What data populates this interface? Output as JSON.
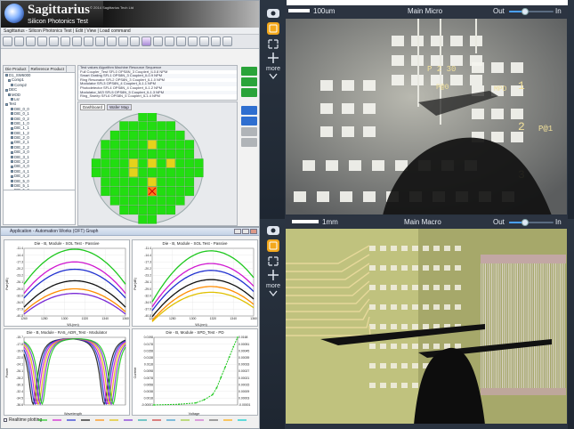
{
  "sagittarius": {
    "app_name": "Sagittarius",
    "copyright": "© 2014 Sagittarius Tech Ltd",
    "subtitle": "Silicon Photonics Test",
    "menu": "Sagittarius - Silicon Photonics Test  |  Edit  |  View  |  Load command",
    "tree_tabs": [
      "Die Product",
      "Reference Product"
    ],
    "tree_items": [
      "D1_SW6000",
      "Comp1",
      "Comp2",
      "DEC",
      "MOD",
      "Lsr",
      "Test",
      "DIE_0_0",
      "DIE_0_1",
      "DIE_0_2",
      "DIE_1_0",
      "DIE_1_1",
      "DIE_1_2",
      "DIE_2_0",
      "DIE_2_1",
      "DIE_2_2",
      "DIE_3_0",
      "DIE_3_1",
      "DIE_3_2",
      "DIE_4_0",
      "DIE_4_1",
      "DIE_4_2",
      "DIE_5_0",
      "DIE_5_1",
      "DIE_5_2",
      "DIE_6_0",
      "DIE_6_1",
      "DIE_6_2",
      "DIE_7_0",
      "DIE_7_1"
    ],
    "params_rows": [
      "Test values   Algorithm     Machine        Resource    Sequence",
      "  Full     Coupler_Test            SFL0     OPS8N_3 Couplert_IL0.8 NPM",
      "  Smart    Grating                 SFL1     OPS8N_3 Couplert_IL0.9 NPM",
      "           Ring Resonator          SFL2     OPS8N_3 Couplert_IL1.0 NPM",
      "           Modulator               SFL3     OPS8N_4 Couplert_IL1.1 NPM",
      "           Photodetector           SFL4     OPS8N_4 Couplert_IL1.2 NPM",
      "           Modulator_MZI           SFL5     OPS8N_5 Couplert_IL1.3 NPM",
      "           Ring_Sweep              SFL6     OPS8N_5 Couplert_IL1.4 NPM"
    ],
    "wafer_tabs": [
      "Dashboard",
      "Wafer Map"
    ],
    "buttons": {
      "colors": [
        "#2aa43a",
        "#2aa43a",
        "#2aa43a",
        "#2f6fd0",
        "#2f6fd0",
        "#b0b4b8",
        "#b0b4b8"
      ]
    },
    "wafer": {
      "pass_color": "#22dd11",
      "select_color": "#e5d21b",
      "fail_color": "#ff7a1a",
      "selected": [
        [
          6,
          3
        ],
        [
          4,
          5
        ],
        [
          6,
          5
        ],
        [
          8,
          5
        ],
        [
          4,
          6
        ],
        [
          6,
          7
        ],
        [
          6,
          8
        ]
      ]
    }
  },
  "automation": {
    "title": "Application - Automation Works (OFT) Graph",
    "realtime_label": "Realtime plotting",
    "plots": [
      {
        "title": "Die - B, Module - SOL Test - Passive",
        "xlabel": "WL(nm)",
        "ylabel": "Pwr(dB)"
      },
      {
        "title": "Die - B, Module - SOL Test - Passive",
        "xlabel": "WL(nm)",
        "ylabel": "Pwr(dB)"
      },
      {
        "title": "Die - B, Module - RA5_ADR_Test - Modulator",
        "xlabel": "Wavelength",
        "ylabel": "Power"
      },
      {
        "title": "Die - B, Module - SPD_Test - PD",
        "xlabel": "Voltage",
        "ylabel": "Current"
      }
    ]
  },
  "chart_data": [
    {
      "type": "line",
      "title": "Die - B, Module - SOL Test - Passive",
      "xlabel": "WL(nm)",
      "ylabel": "Pwr(dB)",
      "xlim": [
        1260,
        1360
      ],
      "ylim": [
        -40.8,
        -11.4
      ],
      "xticks": [
        1260,
        1280,
        1300,
        1320,
        1340,
        1360
      ],
      "yticks": [
        -11.4,
        -14.4,
        -17.3,
        -20.2,
        -23.2,
        -26.1,
        -29.0,
        -32.0,
        -34.9,
        -37.9,
        -40.8
      ],
      "series": [
        {
          "color": "#1ec81e",
          "peak": -11.8,
          "edge": -27,
          "peak_x": 1310
        },
        {
          "color": "#d018d0",
          "peak": -17.3,
          "edge": -31,
          "peak_x": 1310
        },
        {
          "color": "#2030d0",
          "peak": -20.5,
          "edge": -33,
          "peak_x": 1310
        },
        {
          "color": "#111111",
          "peak": -25.5,
          "edge": -37,
          "peak_x": 1310
        },
        {
          "color": "#ff8c00",
          "peak": -29.0,
          "edge": -39,
          "peak_x": 1310
        },
        {
          "color": "#7a2bd6",
          "peak": -31.0,
          "edge": -40,
          "peak_x": 1310
        }
      ]
    },
    {
      "type": "line",
      "title": "Die - B, Module - SOL Test - Passive",
      "xlabel": "WL(nm)",
      "ylabel": "Pwr(dB)",
      "xlim": [
        1260,
        1360
      ],
      "ylim": [
        -40.8,
        -11.4
      ],
      "xticks": [
        1260,
        1280,
        1300,
        1320,
        1340,
        1360
      ],
      "yticks": [
        -11.4,
        -14.4,
        -17.3,
        -20.2,
        -23.2,
        -26.1,
        -29.0,
        -32.0,
        -34.9,
        -37.9,
        -40.8
      ],
      "series": [
        {
          "color": "#1ec81e",
          "peak": -12.5,
          "edge": -29,
          "peak_x": 1318
        },
        {
          "color": "#d018d0",
          "peak": -18.0,
          "edge": -32,
          "peak_x": 1318
        },
        {
          "color": "#2030d0",
          "peak": -21.0,
          "edge": -34,
          "peak_x": 1318
        },
        {
          "color": "#111111",
          "peak": -25.0,
          "edge": -37,
          "peak_x": 1318
        },
        {
          "color": "#ff8c00",
          "peak": -28.0,
          "edge": -39,
          "peak_x": 1318
        },
        {
          "color": "#e0c000",
          "peak": -30.5,
          "edge": -40,
          "peak_x": 1318
        }
      ]
    },
    {
      "type": "line",
      "title": "Die - B, Module - RA5_ADR_Test - Modulator",
      "xlabel": "Wavelength",
      "ylabel": "Power",
      "xlim": [
        1540,
        1560
      ],
      "ylim": [
        -36.6,
        -15.7
      ],
      "yticks": [
        -15.7,
        -17.8,
        -19.9,
        -22.0,
        -24.1,
        -26.1,
        -28.2,
        -30.3,
        -32.4,
        -34.5,
        -36.6
      ],
      "dips": [
        1542.5,
        1556.5
      ],
      "series_colors": [
        "#1a1a1a",
        "#2030d0",
        "#d018d0",
        "#e0c000",
        "#7a2bd6",
        "#1ec81e"
      ]
    },
    {
      "type": "line",
      "title": "Die - B, Module - SPD_Test - PD",
      "xlabel": "Voltage",
      "ylabel": "Current",
      "ylim": [
        -1e-05,
        0.0198
      ],
      "yticks_left": [
        "0.0198",
        "0.0178",
        "0.0158",
        "0.0138",
        "0.0118",
        "0.0098",
        "0.0078",
        "0.0058",
        "0.0038",
        "0.0018",
        "-0.00001"
      ],
      "yticks_right": [
        "0.0168",
        "0.00051",
        "0.00045",
        "0.00039",
        "0.00033",
        "0.00027",
        "0.00021",
        "0.00015",
        "0.00009",
        "0.00003",
        "-0.00001"
      ],
      "color": "#1ec81e",
      "points": [
        [
          0,
          0
        ],
        [
          0.3,
          0.0002
        ],
        [
          0.5,
          0.0006
        ],
        [
          0.6,
          0.0015
        ],
        [
          0.7,
          0.003
        ],
        [
          0.75,
          0.005
        ],
        [
          0.8,
          0.008
        ],
        [
          0.85,
          0.011
        ],
        [
          0.9,
          0.014
        ],
        [
          0.95,
          0.017
        ],
        [
          1.0,
          0.0198
        ]
      ]
    }
  ],
  "micro": {
    "scale_label": "100um",
    "title": "Main Micro",
    "zoom_out": "Out",
    "zoom_in": "In",
    "zoom_level": 0.35,
    "die_labels": [
      "P 2 30",
      "P@0",
      "MPD",
      "1",
      "2",
      "P@1",
      "3"
    ]
  },
  "macro": {
    "scale_label": "1mm",
    "title": "Main Macro",
    "zoom_out": "Out",
    "zoom_in": "In",
    "zoom_level": 0.35
  },
  "sidebar": {
    "more_label": "more",
    "icons": [
      "camera-icon",
      "layers-icon",
      "expand-icon",
      "move-icon",
      "chevron-down-icon"
    ],
    "colors": {
      "bg": "#232c38",
      "active": "#f3a81c",
      "icon": "#dfe5ee"
    }
  },
  "colors": {
    "accent": "#4aa0ff",
    "bar": "#2c3441"
  }
}
